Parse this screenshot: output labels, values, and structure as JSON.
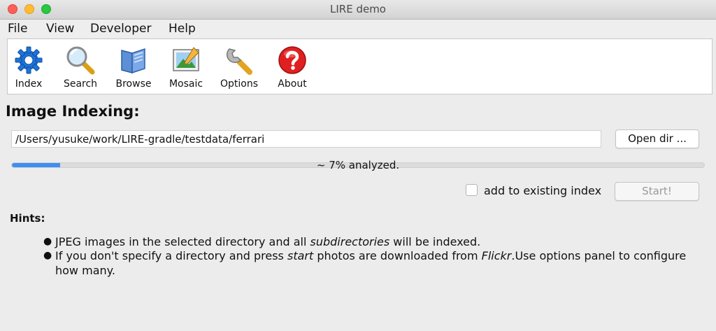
{
  "window": {
    "title": "LIRE demo",
    "controls": [
      "close",
      "minimize",
      "maximize"
    ]
  },
  "menu": {
    "items": [
      "File",
      "View",
      "Developer",
      "Help"
    ]
  },
  "toolbar": {
    "items": [
      {
        "label": "Index",
        "icon": "gear-icon"
      },
      {
        "label": "Search",
        "icon": "magnifier-icon"
      },
      {
        "label": "Browse",
        "icon": "book-icon"
      },
      {
        "label": "Mosaic",
        "icon": "picture-icon"
      },
      {
        "label": "Options",
        "icon": "wrench-icon"
      },
      {
        "label": "About",
        "icon": "help-icon"
      }
    ]
  },
  "indexing": {
    "title": "Image Indexing:",
    "path_value": "/Users/yusuke/work/LIRE-gradle/testdata/ferrari",
    "open_dir_label": "Open dir ...",
    "progress_percent": 7,
    "progress_text": "~ 7% analyzed.",
    "add_to_existing_label": "add to existing index",
    "add_to_existing_checked": false,
    "start_label": "Start!"
  },
  "hints": {
    "title": "Hints:",
    "hint1": {
      "pre": "JPEG images in the selected directory and all ",
      "em": "subdirectories",
      "post": " will be indexed."
    },
    "hint2": {
      "pre": "If you don't specify a directory and press ",
      "em1": "start",
      "mid": " photos are downloaded from ",
      "em2": "Flickr",
      "post": ".Use options panel to configure how many."
    }
  },
  "colors": {
    "progress_fill": "#3f8ff0",
    "window_bg": "#ececec",
    "close": "#fd5f57",
    "minimize": "#febc2e",
    "maximize": "#28c840",
    "about_icon": "#e02020",
    "index_icon": "#1e73d8"
  }
}
